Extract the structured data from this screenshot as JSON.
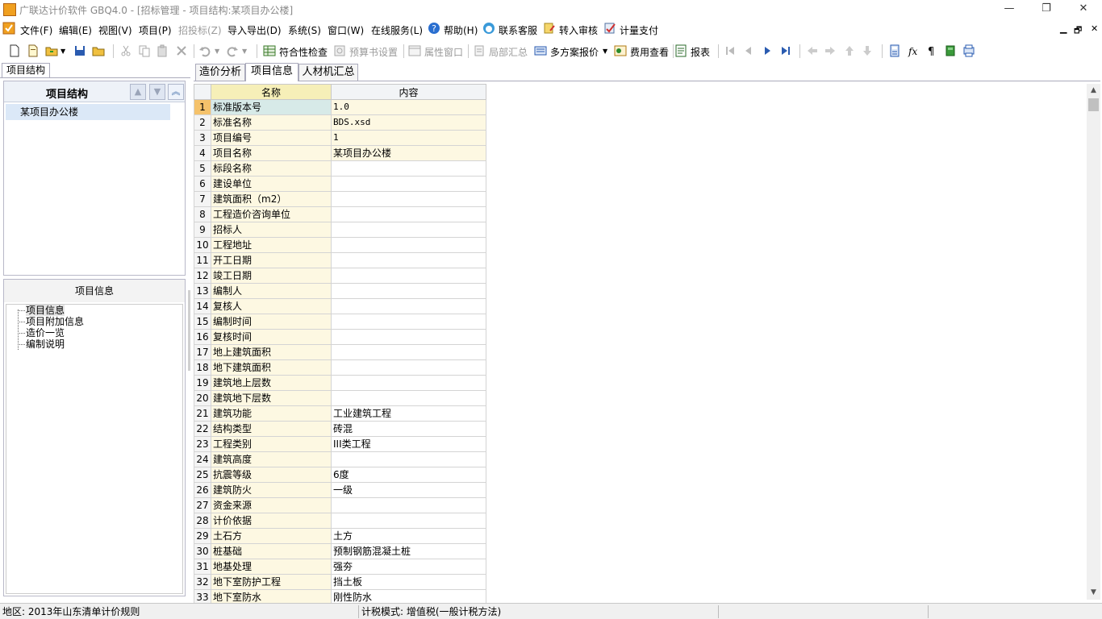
{
  "window": {
    "title": "广联达计价软件 GBQ4.0 - [招标管理 - 项目结构:某项目办公楼]",
    "minimize": "—",
    "restore": "❐",
    "close": "✕"
  },
  "menu": [
    {
      "label": "文件(F)"
    },
    {
      "label": "编辑(E)"
    },
    {
      "label": "视图(V)"
    },
    {
      "label": "项目(P)"
    },
    {
      "label": "招投标(Z)"
    },
    {
      "label": "导入导出(D)"
    },
    {
      "label": "系统(S)"
    },
    {
      "label": "窗口(W)"
    },
    {
      "label": "在线服务(L)"
    },
    {
      "label": "帮助(H)"
    },
    {
      "label": "联系客服"
    },
    {
      "label": "转入审核"
    },
    {
      "label": "计量支付"
    }
  ],
  "mdi": {
    "minimize": "▁",
    "restore": "🗗",
    "close": "✕"
  },
  "toolbar": {
    "compliance_check": "符合性检查",
    "budget_settings": "预算书设置",
    "property_window": "属性窗口",
    "partial_summary": "局部汇总",
    "multi_quote": "多方案报价",
    "fee_view": "费用查看",
    "report": "报表"
  },
  "left_tab": "项目结构",
  "project_panel": {
    "title": "项目结构",
    "items": [
      "某项目办公楼"
    ]
  },
  "info_panel": {
    "title": "项目信息",
    "items": [
      "项目信息",
      "项目附加信息",
      "造价一览",
      "编制说明"
    ]
  },
  "tabs": [
    "造价分析",
    "项目信息",
    "人材机汇总"
  ],
  "active_tab": 1,
  "grid": {
    "headers": [
      "名称",
      "内容"
    ],
    "rows": [
      {
        "n": "1",
        "name": "标准版本号",
        "value": "1.0"
      },
      {
        "n": "2",
        "name": "标准名称",
        "value": "BDS.xsd"
      },
      {
        "n": "3",
        "name": "项目编号",
        "value": "1"
      },
      {
        "n": "4",
        "name": "项目名称",
        "value": "某项目办公楼"
      },
      {
        "n": "5",
        "name": "标段名称",
        "value": ""
      },
      {
        "n": "6",
        "name": "建设单位",
        "value": ""
      },
      {
        "n": "7",
        "name": "建筑面积（m2）",
        "value": ""
      },
      {
        "n": "8",
        "name": "工程造价咨询单位",
        "value": ""
      },
      {
        "n": "9",
        "name": "招标人",
        "value": ""
      },
      {
        "n": "10",
        "name": "工程地址",
        "value": ""
      },
      {
        "n": "11",
        "name": "开工日期",
        "value": ""
      },
      {
        "n": "12",
        "name": "竣工日期",
        "value": ""
      },
      {
        "n": "13",
        "name": "编制人",
        "value": ""
      },
      {
        "n": "14",
        "name": "复核人",
        "value": ""
      },
      {
        "n": "15",
        "name": "编制时间",
        "value": ""
      },
      {
        "n": "16",
        "name": "复核时间",
        "value": ""
      },
      {
        "n": "17",
        "name": "地上建筑面积",
        "value": ""
      },
      {
        "n": "18",
        "name": "地下建筑面积",
        "value": ""
      },
      {
        "n": "19",
        "name": "建筑地上层数",
        "value": ""
      },
      {
        "n": "20",
        "name": "建筑地下层数",
        "value": ""
      },
      {
        "n": "21",
        "name": "建筑功能",
        "value": "工业建筑工程"
      },
      {
        "n": "22",
        "name": "结构类型",
        "value": "砖混"
      },
      {
        "n": "23",
        "name": "工程类别",
        "value": "III类工程"
      },
      {
        "n": "24",
        "name": "建筑高度",
        "value": ""
      },
      {
        "n": "25",
        "name": "抗震等级",
        "value": "6度"
      },
      {
        "n": "26",
        "name": "建筑防火",
        "value": "一级"
      },
      {
        "n": "27",
        "name": "资金来源",
        "value": ""
      },
      {
        "n": "28",
        "name": "计价依据",
        "value": ""
      },
      {
        "n": "29",
        "name": "土石方",
        "value": "土方"
      },
      {
        "n": "30",
        "name": "桩基础",
        "value": "预制钢筋混凝土桩"
      },
      {
        "n": "31",
        "name": "地基处理",
        "value": "强夯"
      },
      {
        "n": "32",
        "name": "地下室防护工程",
        "value": "挡土板"
      },
      {
        "n": "33",
        "name": "地下室防水",
        "value": "刚性防水"
      }
    ]
  },
  "status": {
    "region": "地区: 2013年山东清单计价规则",
    "tax_mode": "计税模式: 增值税(一般计税方法)"
  }
}
